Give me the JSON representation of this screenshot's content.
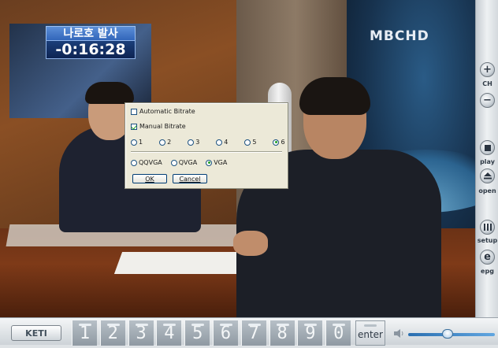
{
  "video": {
    "osd_title": "나로호 발사",
    "osd_time": "-0:16:28",
    "channel_logo": "MBCHD"
  },
  "dialog": {
    "automatic_bitrate": {
      "label": "Automatic Bitrate",
      "checked": false
    },
    "manual_bitrate": {
      "label": "Manual Bitrate",
      "checked": true
    },
    "bitrate_options": [
      "1",
      "2",
      "3",
      "4",
      "5",
      "6"
    ],
    "bitrate_selected": "6",
    "resolution_options": [
      "QQVGA",
      "QVGA",
      "VGA"
    ],
    "resolution_selected": "VGA",
    "ok_label": "OK",
    "cancel_label": "Cancel"
  },
  "right_panel": {
    "ch_plus_symbol": "+",
    "ch_label": "CH",
    "ch_minus_symbol": "−",
    "play_label": "play",
    "open_label": "open",
    "setup_label": "setup",
    "epg_symbol": "e",
    "epg_label": "epg"
  },
  "bottom_bar": {
    "logo": "KETI",
    "digits": [
      "1",
      "2",
      "3",
      "4",
      "5",
      "6",
      "7",
      "8",
      "9",
      "0"
    ],
    "enter_label": "enter",
    "volume_level": 0.45
  }
}
